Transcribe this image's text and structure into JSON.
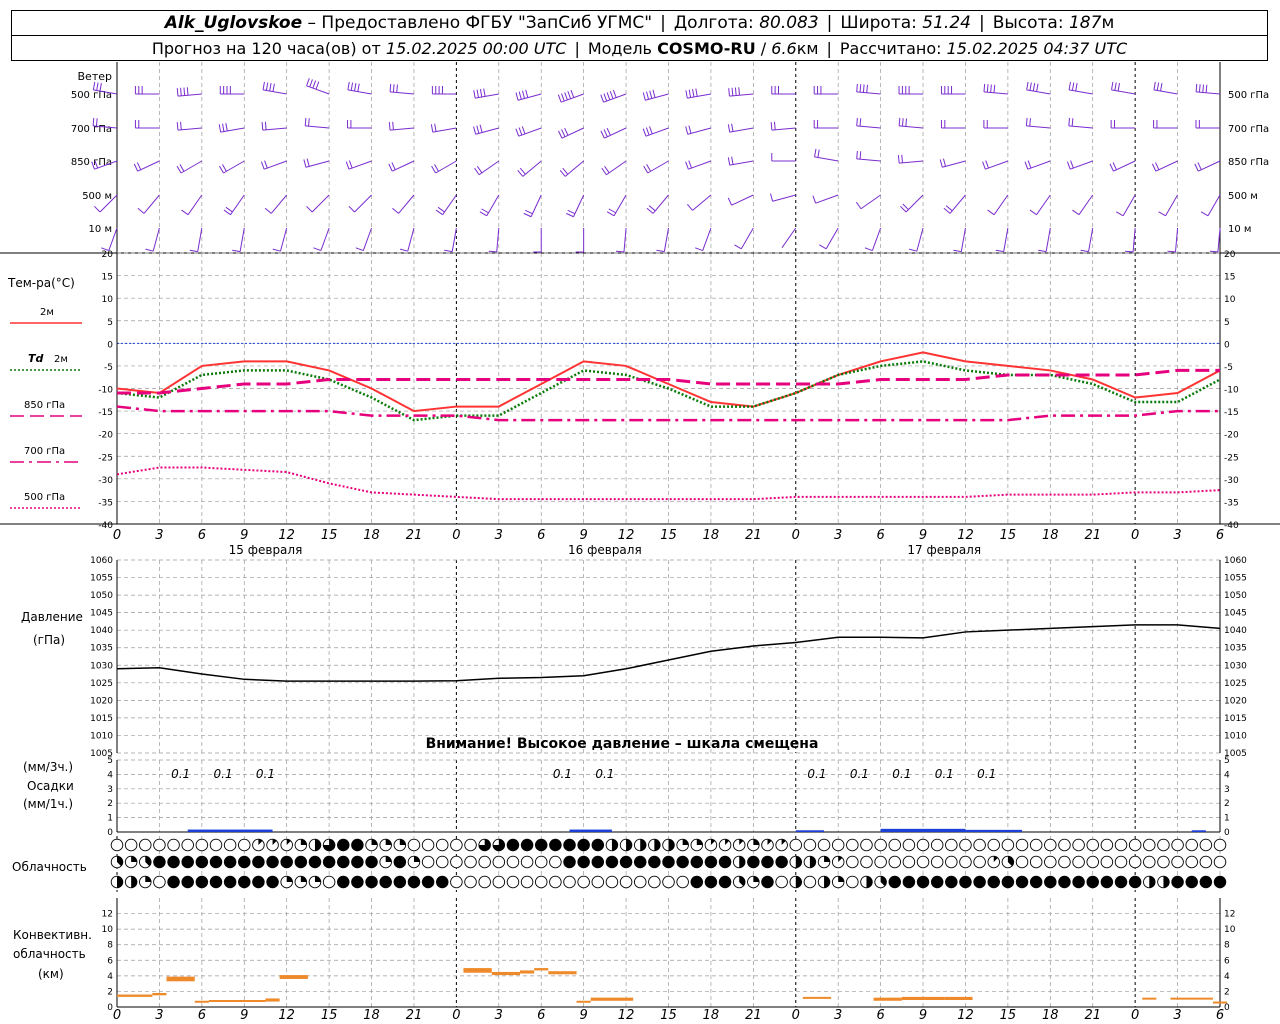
{
  "header": {
    "station": "Alk_Uglovskoe",
    "provider": "– Предоставлено ФГБУ \"ЗапСиб УГМС\"",
    "lon_label": "Долгота:",
    "lon_value": "80.083",
    "lat_label": "Широта:",
    "lat_value": "51.24",
    "alt_label": "Высота:",
    "alt_value": "187",
    "alt_unit": "м",
    "forecast_label": "Прогноз на 120 часа(ов) от",
    "forecast_start": "15.02.2025 00:00 UTC",
    "model_label": "Модель",
    "model_name": "COSMO-RU",
    "model_res": "6.6",
    "model_res_unit": "км",
    "computed_label": "Рассчитано:",
    "computed_value": "15.02.2025 04:37 UTC"
  },
  "colors": {
    "wind": "#7a2ccf",
    "t2m": "#ff3333",
    "td": "#0a7a0a",
    "t850": "#e6007e",
    "t700": "#e6007e",
    "t500": "#e6007e",
    "zero_line": "#1c3fd8",
    "precip": "#1c3fd8",
    "conv": "#ee8a2a",
    "grid": "#9a9a9a"
  },
  "chart_data": [
    {
      "type": "wind_barbs",
      "panel": "wind",
      "title": "Ветер",
      "levels": [
        "500 гПа",
        "700 гПа",
        "850 гПа",
        "500 м",
        "10 м"
      ],
      "x_hours": [
        0,
        3,
        6,
        9,
        12,
        15,
        18,
        21,
        24,
        27,
        30,
        33,
        36,
        39,
        42,
        45,
        48,
        51,
        54,
        57,
        60,
        63,
        66,
        69,
        72,
        75,
        78
      ],
      "directions_deg": {
        "500 гПа": [
          280,
          270,
          265,
          270,
          280,
          290,
          280,
          275,
          270,
          260,
          255,
          250,
          250,
          255,
          260,
          265,
          270,
          270,
          275,
          270,
          270,
          275,
          280,
          280,
          280,
          280,
          275
        ],
        "700 гПа": [
          275,
          270,
          265,
          260,
          265,
          275,
          270,
          265,
          260,
          255,
          250,
          245,
          245,
          250,
          255,
          260,
          265,
          270,
          275,
          275,
          270,
          270,
          275,
          275,
          270,
          270,
          270
        ],
        "850 гПа": [
          250,
          245,
          240,
          240,
          250,
          255,
          250,
          245,
          240,
          235,
          230,
          230,
          235,
          240,
          250,
          260,
          270,
          280,
          275,
          265,
          255,
          250,
          250,
          250,
          245,
          245,
          245
        ],
        "500 м": [
          225,
          220,
          215,
          215,
          220,
          225,
          225,
          220,
          215,
          210,
          205,
          205,
          210,
          220,
          230,
          245,
          255,
          250,
          235,
          225,
          220,
          215,
          215,
          215,
          210,
          210,
          210
        ],
        "10 м": [
          200,
          195,
          190,
          190,
          195,
          200,
          200,
          195,
          190,
          185,
          180,
          180,
          185,
          190,
          200,
          210,
          215,
          210,
          200,
          195,
          190,
          190,
          190,
          190,
          185,
          185,
          185
        ]
      },
      "speeds_ms": {
        "500 гПа": [
          15,
          16,
          18,
          20,
          22,
          20,
          18,
          17,
          18,
          20,
          22,
          25,
          24,
          22,
          20,
          18,
          17,
          16,
          18,
          20,
          22,
          20,
          18,
          17,
          16,
          17,
          18
        ],
        "700 гПа": [
          10,
          11,
          12,
          13,
          12,
          11,
          10,
          11,
          12,
          13,
          14,
          15,
          14,
          13,
          12,
          11,
          10,
          11,
          12,
          13,
          12,
          11,
          11,
          12,
          12,
          12,
          11
        ],
        "850 гПа": [
          8,
          8,
          9,
          10,
          9,
          8,
          8,
          9,
          10,
          11,
          12,
          12,
          11,
          10,
          9,
          8,
          7,
          8,
          9,
          10,
          10,
          9,
          9,
          9,
          9,
          8,
          8
        ],
        "500 м": [
          6,
          6,
          7,
          8,
          7,
          6,
          6,
          7,
          8,
          9,
          10,
          10,
          9,
          8,
          7,
          6,
          5,
          6,
          7,
          8,
          8,
          7,
          7,
          7,
          7,
          6,
          6
        ],
        "10 м": [
          3,
          3,
          4,
          4,
          4,
          3,
          3,
          4,
          4,
          5,
          5,
          5,
          5,
          4,
          3,
          3,
          2,
          3,
          4,
          4,
          4,
          4,
          3,
          3,
          3,
          3,
          3
        ]
      }
    },
    {
      "type": "line",
      "panel": "temperature",
      "title": "Тем-ра(°C)",
      "ylim": [
        -40,
        20
      ],
      "yticks": [
        20,
        15,
        10,
        5,
        0,
        -5,
        -10,
        -15,
        -20,
        -25,
        -30,
        -35,
        -40
      ],
      "x_hours": [
        0,
        3,
        6,
        9,
        12,
        15,
        18,
        21,
        24,
        27,
        30,
        33,
        36,
        39,
        42,
        45,
        48,
        51,
        54,
        57,
        60,
        63,
        66,
        69,
        72,
        75,
        78
      ],
      "series": [
        {
          "name": "2м",
          "key": "t2m",
          "style": "solid",
          "values": [
            -10,
            -11,
            -5,
            -4,
            -4,
            -6,
            -10,
            -15,
            -14,
            -14,
            -9,
            -4,
            -5,
            -9,
            -13,
            -14,
            -11,
            -7,
            -4,
            -2,
            -4,
            -5,
            -6,
            -8,
            -12,
            -11,
            -6
          ]
        },
        {
          "name": "Td 2м",
          "key": "td",
          "style": "dotted",
          "values": [
            -11,
            -12,
            -7,
            -6,
            -6,
            -8,
            -12,
            -17,
            -16,
            -16,
            -11,
            -6,
            -7,
            -10,
            -14,
            -14,
            -11,
            -7,
            -5,
            -4,
            -6,
            -7,
            -7,
            -9,
            -13,
            -13,
            -8
          ]
        },
        {
          "name": "850 гПа",
          "key": "t850",
          "style": "dash",
          "values": [
            -11,
            -11,
            -10,
            -9,
            -9,
            -8,
            -8,
            -8,
            -8,
            -8,
            -8,
            -8,
            -8,
            -8,
            -9,
            -9,
            -9,
            -9,
            -8,
            -8,
            -8,
            -7,
            -7,
            -7,
            -7,
            -6,
            -6
          ]
        },
        {
          "name": "700 гПа",
          "key": "t700",
          "style": "dashdot",
          "values": [
            -14,
            -15,
            -15,
            -15,
            -15,
            -15,
            -16,
            -16,
            -16,
            -17,
            -17,
            -17,
            -17,
            -17,
            -17,
            -17,
            -17,
            -17,
            -17,
            -17,
            -17,
            -17,
            -16,
            -16,
            -16,
            -15,
            -15
          ]
        },
        {
          "name": "500 гПа",
          "key": "t500",
          "style": "dotted_fine",
          "values": [
            -29,
            -27.5,
            -27.5,
            -28,
            -28.5,
            -31,
            -33,
            -33.5,
            -34,
            -34.5,
            -34.5,
            -34.5,
            -34.5,
            -34.5,
            -34.5,
            -34.5,
            -34,
            -34,
            -34,
            -34,
            -34,
            -33.5,
            -33.5,
            -33.5,
            -33,
            -33,
            -32.5
          ]
        }
      ]
    },
    {
      "type": "line",
      "panel": "pressure",
      "title": "Давление",
      "ylabel": "(гПа)",
      "ylim": [
        1005,
        1060
      ],
      "yticks": [
        1060,
        1055,
        1050,
        1045,
        1040,
        1035,
        1030,
        1025,
        1020,
        1015,
        1010,
        1005
      ],
      "x_hours": [
        0,
        3,
        6,
        9,
        12,
        15,
        18,
        21,
        24,
        27,
        30,
        33,
        36,
        39,
        42,
        45,
        48,
        51,
        54,
        57,
        60,
        63,
        66,
        69,
        72,
        75,
        78
      ],
      "series": [
        {
          "name": "",
          "values": [
            1029,
            1029.3,
            1027.5,
            1026,
            1025.5,
            1025.5,
            1025.5,
            1025.5,
            1025.6,
            1026.3,
            1026.5,
            1027,
            1029,
            1031.5,
            1034,
            1035.5,
            1036.5,
            1038,
            1038,
            1037.8,
            1039.5,
            1040,
            1040.5,
            1041,
            1041.5,
            1041.5,
            1040.5
          ]
        }
      ],
      "annotation": "Внимание! Высокое давление – шкала смещена"
    },
    {
      "type": "bar",
      "panel": "precipitation",
      "title": "Осадки",
      "ylabel_top": "(мм/3ч.)",
      "ylabel_bottom": "(мм/1ч.)",
      "ylim": [
        0,
        5
      ],
      "yticks": [
        5,
        4,
        3,
        2,
        1,
        0
      ],
      "labels": [
        {
          "hour": 4.5,
          "text": "0.1"
        },
        {
          "hour": 7.5,
          "text": "0.1"
        },
        {
          "hour": 10.5,
          "text": "0.1"
        },
        {
          "hour": 31.5,
          "text": "0.1"
        },
        {
          "hour": 34.5,
          "text": "0.1"
        },
        {
          "hour": 49.5,
          "text": "0.1"
        },
        {
          "hour": 52.5,
          "text": "0.1"
        },
        {
          "hour": 55.5,
          "text": "0.1"
        },
        {
          "hour": 58.5,
          "text": "0.1"
        },
        {
          "hour": 61.5,
          "text": "0.1"
        }
      ],
      "bars_hours": [
        [
          5,
          11,
          0.1
        ],
        [
          32,
          35,
          0.1
        ],
        [
          48,
          50,
          0.05
        ],
        [
          54,
          60,
          0.15
        ],
        [
          60,
          64,
          0.08
        ],
        [
          76,
          77,
          0.05
        ]
      ]
    },
    {
      "type": "table",
      "panel": "cloudiness",
      "title": "Облачность",
      "scale": "octas 0-8",
      "rows": {
        "upper": [
          0,
          0,
          0,
          0,
          0,
          0,
          0,
          0,
          0,
          0,
          1,
          1,
          1,
          2,
          4,
          6,
          8,
          8,
          2,
          2,
          2,
          0,
          0,
          0,
          0,
          0,
          6,
          6,
          8,
          8,
          8,
          8,
          8,
          8,
          8,
          4,
          4,
          4,
          4,
          4,
          2,
          2,
          1,
          1,
          1,
          2,
          1,
          1,
          0,
          0,
          0,
          0,
          0,
          0,
          0,
          0,
          0,
          0,
          0,
          0,
          0,
          0,
          0,
          0,
          0,
          0,
          0,
          0,
          0,
          0,
          0,
          0,
          0,
          0,
          0,
          0,
          0,
          0,
          0
        ],
        "middle": [
          3,
          2,
          3,
          8,
          8,
          8,
          8,
          8,
          8,
          8,
          8,
          8,
          8,
          8,
          8,
          8,
          8,
          8,
          8,
          2,
          8,
          2,
          0,
          0,
          0,
          0,
          0,
          0,
          0,
          0,
          0,
          0,
          8,
          8,
          8,
          8,
          8,
          8,
          8,
          8,
          8,
          8,
          8,
          8,
          4,
          8,
          8,
          8,
          4,
          4,
          2,
          1,
          0,
          0,
          0,
          0,
          0,
          0,
          0,
          0,
          0,
          0,
          1,
          3,
          0,
          0,
          0,
          0,
          0,
          0,
          0,
          0,
          0,
          0,
          0,
          0,
          0,
          0,
          0
        ],
        "lower": [
          4,
          4,
          2,
          0,
          8,
          8,
          8,
          8,
          8,
          8,
          8,
          8,
          2,
          2,
          2,
          0,
          8,
          8,
          8,
          8,
          8,
          8,
          8,
          8,
          0,
          0,
          0,
          0,
          0,
          0,
          0,
          0,
          0,
          0,
          0,
          0,
          0,
          0,
          0,
          0,
          0,
          8,
          8,
          8,
          3,
          2,
          8,
          0,
          4,
          0,
          4,
          2,
          0,
          4,
          3,
          8,
          8,
          8,
          8,
          8,
          8,
          8,
          8,
          8,
          8,
          8,
          8,
          8,
          8,
          8,
          8,
          8,
          8,
          4,
          4,
          8,
          8,
          8,
          8
        ]
      }
    },
    {
      "type": "bar",
      "panel": "convective",
      "title": "Конвективн. облачность",
      "ylabel": "(км)",
      "ylim": [
        0,
        14
      ],
      "yticks": [
        12,
        10,
        8,
        6,
        4,
        2,
        0
      ],
      "segments": [
        {
          "from_h": 0,
          "to_h": 2.5,
          "base": 1.3,
          "top": 1.6
        },
        {
          "from_h": 2.5,
          "to_h": 3.5,
          "base": 1.5,
          "top": 1.8
        },
        {
          "from_h": 3.5,
          "to_h": 5.5,
          "base": 3.3,
          "top": 3.9
        },
        {
          "from_h": 5.5,
          "to_h": 6.5,
          "base": 0.6,
          "top": 0.8
        },
        {
          "from_h": 6.5,
          "to_h": 10.5,
          "base": 0.7,
          "top": 0.9
        },
        {
          "from_h": 10.5,
          "to_h": 11.5,
          "base": 0.7,
          "top": 1.1
        },
        {
          "from_h": 11.5,
          "to_h": 13.5,
          "base": 3.6,
          "top": 4.1
        },
        {
          "from_h": 24.5,
          "to_h": 26.5,
          "base": 4.4,
          "top": 5.0
        },
        {
          "from_h": 26.5,
          "to_h": 28.5,
          "base": 4.1,
          "top": 4.5
        },
        {
          "from_h": 28.5,
          "to_h": 29.5,
          "base": 4.3,
          "top": 4.7
        },
        {
          "from_h": 29.5,
          "to_h": 30.5,
          "base": 4.7,
          "top": 5.0
        },
        {
          "from_h": 30.5,
          "to_h": 32.5,
          "base": 4.2,
          "top": 4.6
        },
        {
          "from_h": 32.5,
          "to_h": 33.5,
          "base": 0.6,
          "top": 0.8
        },
        {
          "from_h": 33.5,
          "to_h": 36.5,
          "base": 0.8,
          "top": 1.2
        },
        {
          "from_h": 48.5,
          "to_h": 50.5,
          "base": 1.1,
          "top": 1.3
        },
        {
          "from_h": 53.5,
          "to_h": 55.5,
          "base": 0.8,
          "top": 1.2
        },
        {
          "from_h": 55.5,
          "to_h": 58.5,
          "base": 0.9,
          "top": 1.3
        },
        {
          "from_h": 58.5,
          "to_h": 60.5,
          "base": 0.9,
          "top": 1.3
        },
        {
          "from_h": 72.5,
          "to_h": 73.5,
          "base": 1.0,
          "top": 1.2
        },
        {
          "from_h": 74.5,
          "to_h": 77.5,
          "base": 1.0,
          "top": 1.2
        },
        {
          "from_h": 77.5,
          "to_h": 78.5,
          "base": 0.5,
          "top": 0.7
        }
      ]
    }
  ],
  "x_axis": {
    "hour_ticks": [
      "0",
      "3",
      "6",
      "9",
      "12",
      "15",
      "18",
      "21",
      "0",
      "3",
      "6",
      "9",
      "12",
      "15",
      "18",
      "21",
      "0",
      "3",
      "6",
      "9",
      "12",
      "15",
      "18",
      "21",
      "0",
      "3",
      "6"
    ],
    "days": [
      {
        "label": "15 февраля",
        "at_hour": 10.5
      },
      {
        "label": "16 февраля",
        "at_hour": 34.5
      },
      {
        "label": "17 февраля",
        "at_hour": 58.5
      }
    ]
  },
  "legend": {
    "wind_title": "Ветер",
    "temp_title": "Тем-ра(°C)",
    "t2m": "2м",
    "td_symbol": "Td",
    "td_level": "2м",
    "t850": "850 гПа",
    "t700": "700 гПа",
    "t500": "500 гПа",
    "pressure_title": "Давление",
    "pressure_unit": "(гПа)",
    "precip_unit3": "(мм/3ч.)",
    "precip_title": "Осадки",
    "precip_unit1": "(мм/1ч.)",
    "cloud_title": "Облачность",
    "conv_title1": "Конвективн.",
    "conv_title2": "облачность",
    "conv_unit": "(км)"
  }
}
